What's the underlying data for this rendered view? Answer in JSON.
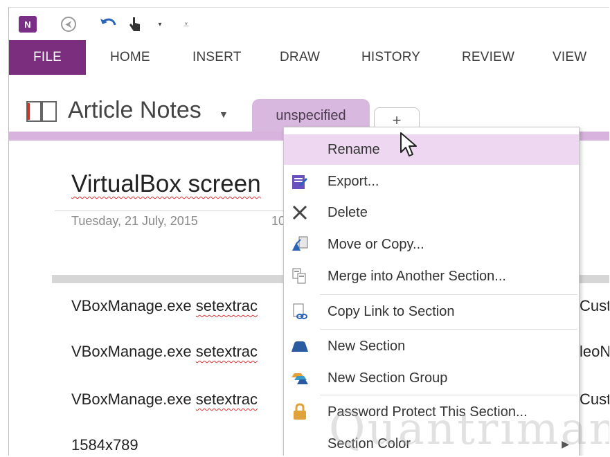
{
  "qat": {
    "app_icon_label": "N",
    "touch_caret": "▾",
    "customize": "⩡"
  },
  "ribbon": {
    "tabs": [
      "FILE",
      "HOME",
      "INSERT",
      "DRAW",
      "HISTORY",
      "REVIEW",
      "VIEW"
    ]
  },
  "notebook": {
    "title": "Article Notes",
    "caret": "▼",
    "section_tab": "unspecified",
    "add_tab": "+"
  },
  "page": {
    "title_visible": "VirtualBox screen",
    "date": "Tuesday, 21 July, 2015",
    "time_fragment": "10",
    "rows": [
      {
        "prefix": "VBoxManage.exe ",
        "cmd": "setextrac"
      },
      {
        "prefix": "VBoxManage.exe ",
        "cmd": "setextrac"
      },
      {
        "prefix": "VBoxManage.exe ",
        "cmd": "setextrac"
      },
      {
        "prefix": "1584x789",
        "cmd": ""
      }
    ],
    "right_fragments": [
      "Cust",
      "leoN",
      "Cust"
    ]
  },
  "context_menu": {
    "items": [
      {
        "label": "Rename",
        "icon": "rename-icon"
      },
      {
        "label": "Export...",
        "icon": "export-icon"
      },
      {
        "label": "Delete",
        "icon": "delete-icon"
      },
      {
        "label": "Move or Copy...",
        "icon": "move-copy-icon"
      },
      {
        "label": "Merge into Another Section...",
        "icon": "merge-icon"
      },
      {
        "label": "Copy Link to Section",
        "icon": "copy-link-icon"
      },
      {
        "label": "New Section",
        "icon": "new-section-icon"
      },
      {
        "label": "New Section Group",
        "icon": "new-section-group-icon"
      },
      {
        "label": "Password Protect This Section...",
        "icon": "lock-icon"
      },
      {
        "label": "Section Color",
        "icon": "section-color-icon"
      }
    ],
    "submenu_arrow": "▶"
  },
  "watermark": "Quantrimang",
  "colors": {
    "file_tab": "#7b2e7d",
    "section_tab": "#d9b8df",
    "menu_highlight": "#eed8f1",
    "accent_blue": "#2a63b7"
  }
}
